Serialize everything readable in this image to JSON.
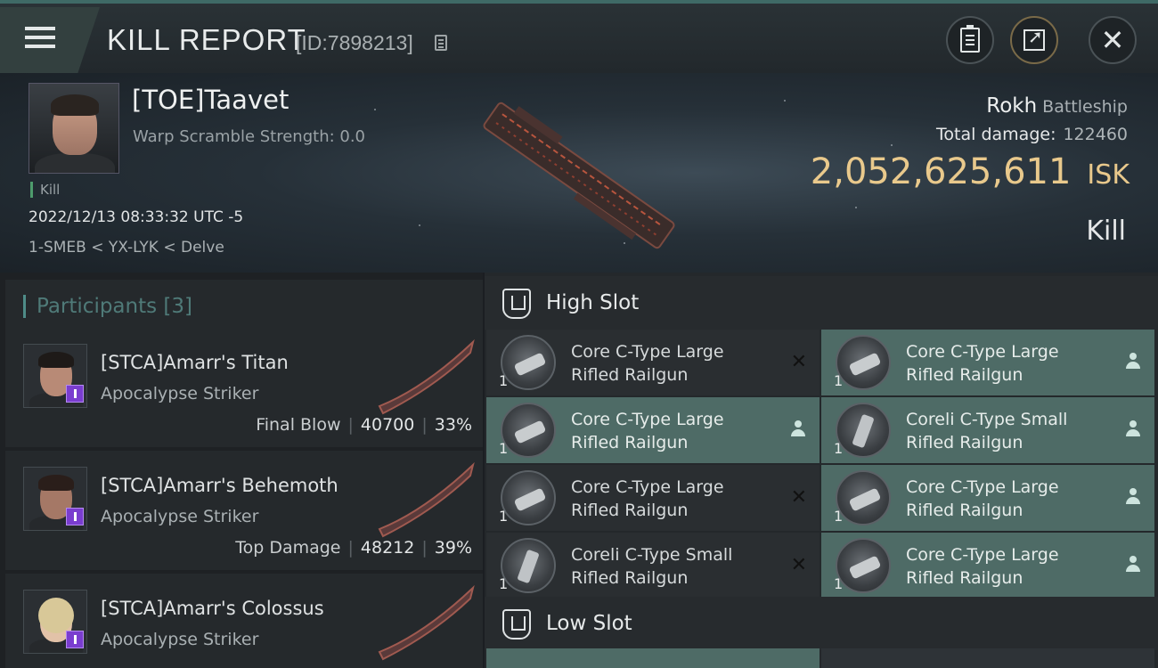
{
  "header": {
    "title": "KILL REPORT",
    "report_id": "[ID:7898213]",
    "icons": [
      "menu-icon",
      "copy-icon",
      "clipboard-icon",
      "share-icon",
      "close-icon"
    ]
  },
  "victim": {
    "name": "[TOE]Taavet",
    "warp_scramble": "Warp Scramble Strength: 0.0",
    "tag": "Kill",
    "datetime": "2022/12/13 08:33:32 UTC -5",
    "location": "1-SMEB < YX-LYK < Delve",
    "ship_name": "Rokh",
    "ship_class": "Battleship",
    "total_damage_label": "Total damage:",
    "total_damage": "122460",
    "isk_value": "2,052,625,611",
    "isk_unit": "ISK",
    "result": "Kill"
  },
  "participants": {
    "label": "Participants",
    "count": "[3]",
    "items": [
      {
        "name": "[STCA]Amarr's Titan",
        "ship": "Apocalypse Striker",
        "stat_label": "Final Blow",
        "damage": "40700",
        "percent": "33%"
      },
      {
        "name": "[STCA]Amarr's Behemoth",
        "ship": "Apocalypse Striker",
        "stat_label": "Top Damage",
        "damage": "48212",
        "percent": "39%"
      },
      {
        "name": "[STCA]Amarr's Colossus",
        "ship": "Apocalypse Striker",
        "stat_label": "",
        "damage": "",
        "percent": ""
      }
    ]
  },
  "high_slot": {
    "title": "High Slot",
    "modules": [
      {
        "qty": "1",
        "line1": "Core C-Type Large",
        "line2": "Rifled Railgun",
        "status": "destroyed"
      },
      {
        "qty": "1",
        "line1": "Core C-Type Large",
        "line2": "Rifled Railgun",
        "status": "dropped"
      },
      {
        "qty": "1",
        "line1": "Core C-Type Large",
        "line2": "Rifled Railgun",
        "status": "dropped"
      },
      {
        "qty": "1",
        "line1": "Coreli C-Type Small",
        "line2": "Rifled Railgun",
        "status": "dropped"
      },
      {
        "qty": "1",
        "line1": "Core C-Type Large",
        "line2": "Rifled Railgun",
        "status": "destroyed"
      },
      {
        "qty": "1",
        "line1": "Core C-Type Large",
        "line2": "Rifled Railgun",
        "status": "dropped"
      },
      {
        "qty": "1",
        "line1": "Coreli C-Type Small",
        "line2": "Rifled Railgun",
        "status": "destroyed"
      },
      {
        "qty": "1",
        "line1": "Core C-Type Large",
        "line2": "Rifled Railgun",
        "status": "dropped"
      }
    ]
  },
  "low_slot": {
    "title": "Low Slot"
  },
  "colors": {
    "accent_teal": "#4e6b66",
    "isk_gold": "#e9c98c",
    "badge_purple": "#7a3dcf"
  }
}
